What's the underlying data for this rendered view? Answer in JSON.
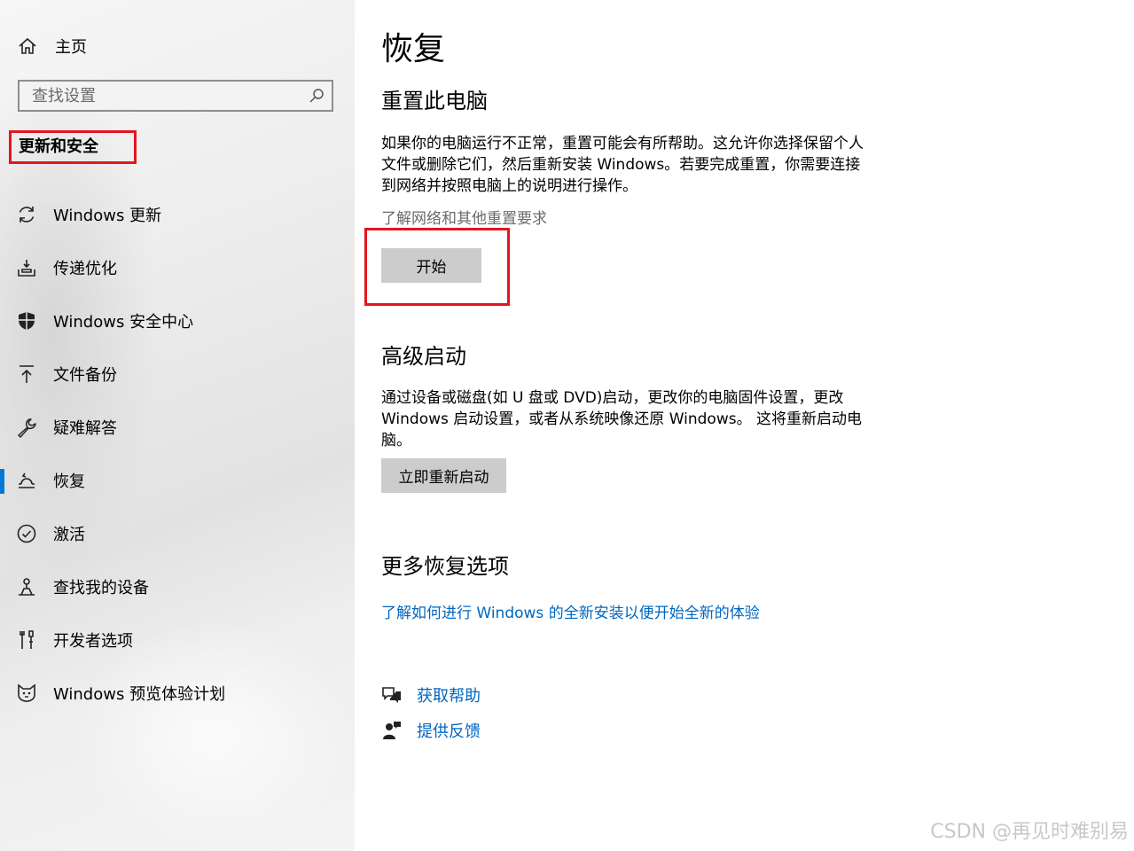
{
  "sidebar": {
    "home_label": "主页",
    "search_placeholder": "查找设置",
    "section_title": "更新和安全",
    "items": [
      {
        "label": "Windows 更新",
        "icon": "refresh-icon"
      },
      {
        "label": "传递优化",
        "icon": "delivery-optimization-icon"
      },
      {
        "label": "Windows 安全中心",
        "icon": "shield-icon"
      },
      {
        "label": "文件备份",
        "icon": "backup-arrow-icon"
      },
      {
        "label": "疑难解答",
        "icon": "wrench-icon"
      },
      {
        "label": "恢复",
        "icon": "recovery-icon",
        "selected": true
      },
      {
        "label": "激活",
        "icon": "check-circle-icon"
      },
      {
        "label": "查找我的设备",
        "icon": "find-device-icon"
      },
      {
        "label": "开发者选项",
        "icon": "developer-tools-icon"
      },
      {
        "label": "Windows 预览体验计划",
        "icon": "insider-cat-icon"
      }
    ]
  },
  "main": {
    "title": "恢复",
    "reset": {
      "heading": "重置此电脑",
      "description_lines": [
        "如果你的电脑运行不正常，重置可能会有所帮助。这允许你选择保留个人",
        "文件或删除它们，然后重新安装 Windows。若要完成重置，你需要连接",
        "到网络并按照电脑上的说明进行操作。"
      ],
      "learn_more": "了解网络和其他重置要求",
      "button": "开始"
    },
    "advanced": {
      "heading": "高级启动",
      "description_lines": [
        "通过设备或磁盘(如 U 盘或 DVD)启动，更改你的电脑固件设置，更改",
        "Windows 启动设置，或者从系统映像还原 Windows。 这将重新启动电",
        "脑。"
      ],
      "button": "立即重新启动"
    },
    "more": {
      "heading": "更多恢复选项",
      "link": "了解如何进行 Windows 的全新安装以便开始全新的体验"
    },
    "help": {
      "get_help": "获取帮助",
      "feedback": "提供反馈"
    }
  },
  "watermark": "CSDN @再见时难别易",
  "colors": {
    "accent": "#0078d7",
    "link": "#0067c0",
    "highlight": "#e5141e",
    "button": "#cccccc"
  }
}
